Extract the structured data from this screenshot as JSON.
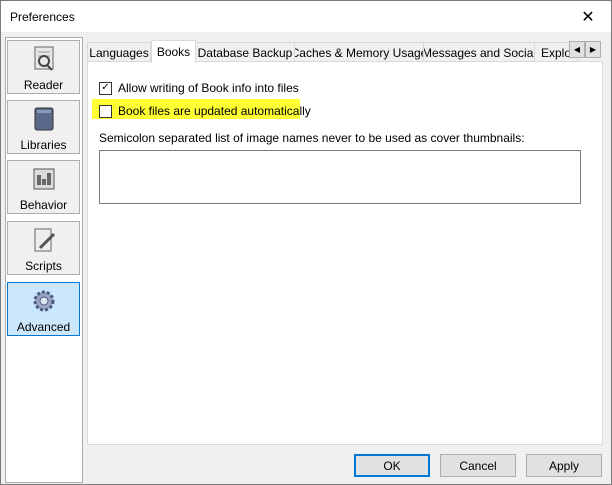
{
  "window": {
    "title": "Preferences"
  },
  "sidebar": {
    "items": [
      {
        "label": "Reader",
        "icon": "reader-icon"
      },
      {
        "label": "Libraries",
        "icon": "libraries-icon"
      },
      {
        "label": "Behavior",
        "icon": "behavior-icon"
      },
      {
        "label": "Scripts",
        "icon": "scripts-icon"
      },
      {
        "label": "Advanced",
        "icon": "advanced-gear-icon",
        "selected": true
      }
    ]
  },
  "tabs": [
    {
      "label": "Languages"
    },
    {
      "label": "Books",
      "active": true
    },
    {
      "label": "Database Backup"
    },
    {
      "label": "Caches & Memory Usage"
    },
    {
      "label": "Messages and Social"
    },
    {
      "label": "Explo"
    }
  ],
  "books_tab": {
    "allow_writing": {
      "label": "Allow writing of Book info into files",
      "checked": true
    },
    "auto_update": {
      "label": "Book files are updated automatically",
      "checked": false
    },
    "exclusion_list": {
      "label": "Semicolon separated list of image names never to be used as cover thumbnails:",
      "value": ""
    }
  },
  "buttons": {
    "ok": "OK",
    "cancel": "Cancel",
    "apply": "Apply"
  },
  "colors": {
    "highlight": "#ffff33",
    "selected_bg": "#cce8ff",
    "selected_border": "#0078d7"
  }
}
